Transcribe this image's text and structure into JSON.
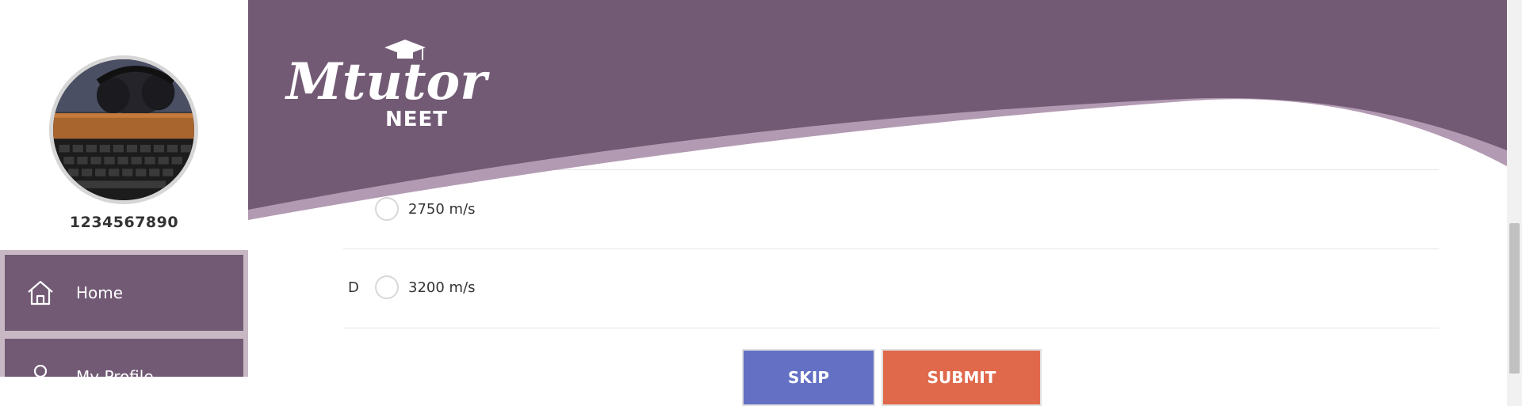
{
  "sidebar": {
    "username": "1234567890",
    "menu": [
      {
        "label": "Home",
        "icon": "home-icon"
      },
      {
        "label": "My Profile",
        "icon": "user-icon"
      }
    ]
  },
  "header": {
    "logo_text": "Mtutor",
    "logo_sub": "NEET",
    "brand_color": "#725a75",
    "wave_light_color": "#b39ab3"
  },
  "question": {
    "options": [
      {
        "letter": "",
        "text": "2750 m/s"
      },
      {
        "letter": "D",
        "text": "3200 m/s"
      }
    ]
  },
  "actions": {
    "skip_label": "SKIP",
    "submit_label": "SUBMIT",
    "skip_color": "#6470c4",
    "submit_color": "#e0694c"
  }
}
